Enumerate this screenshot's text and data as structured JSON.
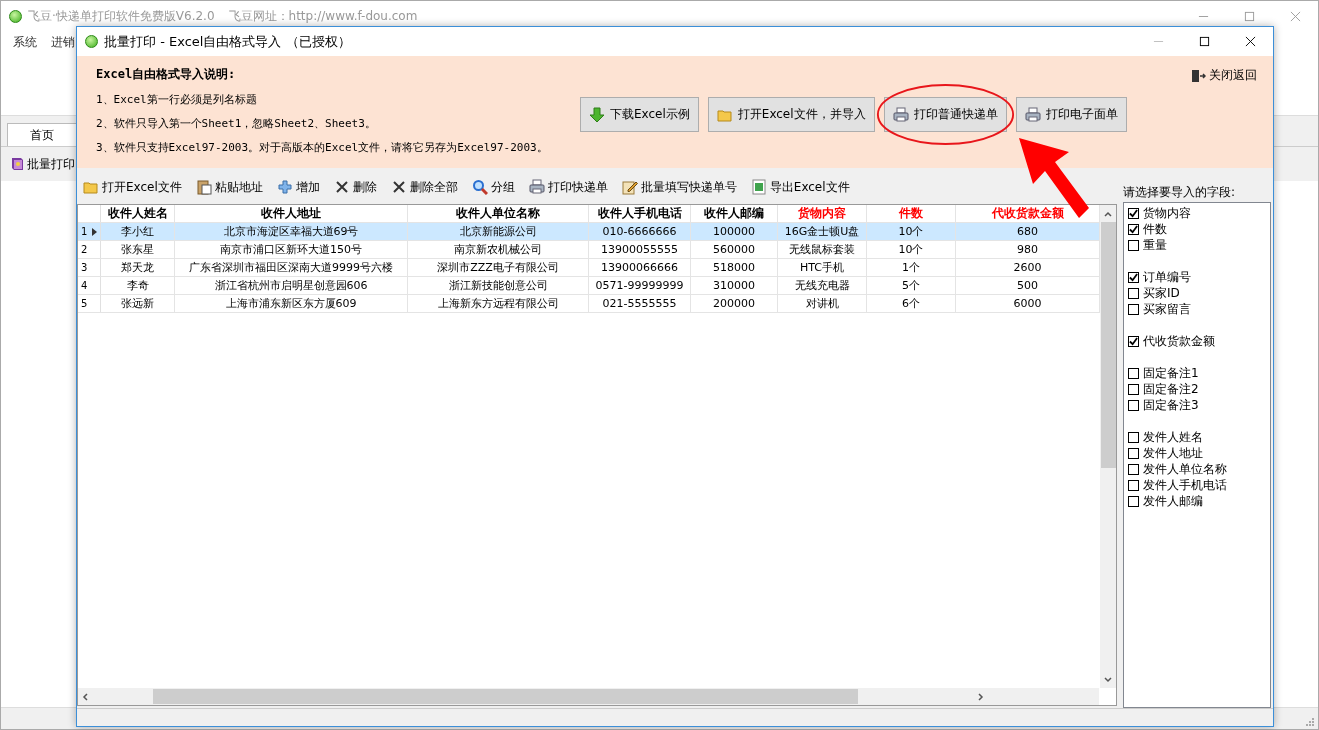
{
  "main_window": {
    "title": "飞豆·快递单打印软件免费版V6.2.0",
    "website": "飞豆网址：http://www.f-dou.com",
    "menu": [
      "系统",
      "进销"
    ],
    "tabs": [
      {
        "label": "首页",
        "selected": true
      }
    ],
    "nav_item": "批量打印"
  },
  "dialog": {
    "title": "批量打印 - Excel自由格式导入 （已授权）",
    "instructions": {
      "heading": "Excel自由格式导入说明:",
      "lines": [
        "1、Excel第一行必须是列名标题",
        "2、软件只导入第一个Sheet1，忽略Sheet2、Sheet3。",
        "3、软件只支持Excel97-2003。对于高版本的Excel文件，请将它另存为Excel97-2003。"
      ]
    },
    "close_link": "关闭返回",
    "buttons": [
      "下载Excel示例",
      "打开Excel文件，并导入",
      "打印普通快递单",
      "打印电子面单"
    ],
    "toolbar": [
      "打开Excel文件",
      "粘贴地址",
      "增加",
      "删除",
      "删除全部",
      "分组",
      "打印快递单",
      "批量填写快递单号",
      "导出Excel文件"
    ],
    "table": {
      "columns": [
        {
          "label": "收件人姓名",
          "color": "#000000"
        },
        {
          "label": "收件人地址",
          "color": "#000000"
        },
        {
          "label": "收件人单位名称",
          "color": "#000000"
        },
        {
          "label": "收件人手机电话",
          "color": "#000000"
        },
        {
          "label": "收件人邮编",
          "color": "#000000"
        },
        {
          "label": "货物内容",
          "color": "#ff0000"
        },
        {
          "label": "件数",
          "color": "#ff0000"
        },
        {
          "label": "代收货款金额",
          "color": "#ff0000"
        }
      ],
      "rows": [
        {
          "number": "1",
          "selected": true,
          "cells": [
            "李小红",
            "北京市海淀区幸福大道69号",
            "北京新能源公司",
            "010-6666666",
            "100000",
            "16G金士顿U盘",
            "10个",
            "680"
          ]
        },
        {
          "number": "2",
          "selected": false,
          "cells": [
            "张东星",
            "南京市浦口区新环大道150号",
            "南京新农机械公司",
            "13900055555",
            "560000",
            "无线鼠标套装",
            "10个",
            "980"
          ]
        },
        {
          "number": "3",
          "selected": false,
          "cells": [
            "郑天龙",
            "广东省深圳市福田区深南大道9999号六楼",
            "深圳市ZZZ电子有限公司",
            "13900066666",
            "518000",
            "HTC手机",
            "1个",
            "2600"
          ]
        },
        {
          "number": "4",
          "selected": false,
          "cells": [
            "李奇",
            "浙江省杭州市启明星创意园606",
            "浙江新技能创意公司",
            "0571-99999999",
            "310000",
            "无线充电器",
            "5个",
            "500"
          ]
        },
        {
          "number": "5",
          "selected": false,
          "cells": [
            "张远新",
            "上海市浦东新区东方厦609",
            "上海新东方远程有限公司",
            "021-5555555",
            "200000",
            "对讲机",
            "6个",
            "6000"
          ]
        }
      ]
    },
    "fields": {
      "label": "请选择要导入的字段:",
      "groups": [
        [
          {
            "label": "货物内容",
            "checked": true
          },
          {
            "label": "件数",
            "checked": true
          },
          {
            "label": "重量",
            "checked": false
          }
        ],
        [
          {
            "label": "订单编号",
            "checked": true
          },
          {
            "label": "买家ID",
            "checked": false
          },
          {
            "label": "买家留言",
            "checked": false
          }
        ],
        [
          {
            "label": "代收货款金额",
            "checked": true
          }
        ],
        [
          {
            "label": "固定备注1",
            "checked": false
          },
          {
            "label": "固定备注2",
            "checked": false
          },
          {
            "label": "固定备注3",
            "checked": false
          }
        ],
        [
          {
            "label": "发件人姓名",
            "checked": false
          },
          {
            "label": "发件人地址",
            "checked": false
          },
          {
            "label": "发件人单位名称",
            "checked": false
          },
          {
            "label": "发件人手机电话",
            "checked": false
          },
          {
            "label": "发件人邮编",
            "checked": false
          }
        ]
      ]
    }
  }
}
